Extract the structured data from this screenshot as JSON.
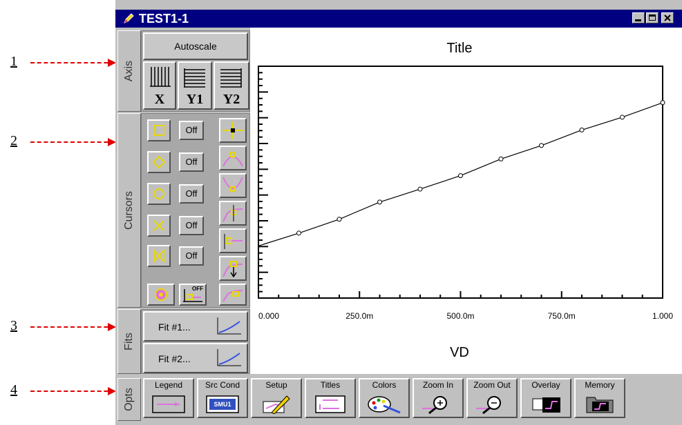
{
  "annotations": [
    {
      "number": "1"
    },
    {
      "number": "2"
    },
    {
      "number": "3"
    },
    {
      "number": "4"
    }
  ],
  "window": {
    "title": "TEST1-1"
  },
  "side_tabs": {
    "axis": "Axis",
    "cursors": "Cursors",
    "fits": "Fits",
    "opts": "Opts"
  },
  "axis_panel": {
    "autoscale_label": "Autoscale",
    "x_label": "X",
    "y1_label": "Y1",
    "y2_label": "Y2"
  },
  "cursors_panel": {
    "rows": [
      {
        "shape": "square-cursor-icon",
        "state": "Off"
      },
      {
        "shape": "diamond-cursor-icon",
        "state": "Off"
      },
      {
        "shape": "circle-cursor-icon",
        "state": "Off"
      },
      {
        "shape": "x-cursor-icon",
        "state": "Off"
      },
      {
        "shape": "bowtie-cursor-icon",
        "state": "Off"
      }
    ],
    "off_small_label": "OFF"
  },
  "fits_panel": {
    "fit1_label": "Fit #1...",
    "fit2_label": "Fit #2..."
  },
  "toolbar": {
    "legend": "Legend",
    "src_cond": "Src Cond",
    "src_cond_badge": "SMU1",
    "setup": "Setup",
    "titles": "Titles",
    "colors": "Colors",
    "zoom_in": "Zoom In",
    "zoom_out": "Zoom Out",
    "overlay": "Overlay",
    "memory": "Memory"
  },
  "chart_data": {
    "type": "line",
    "title": "Title",
    "xlabel": "VD",
    "ylabel": "",
    "x_tick_labels": [
      "0.000",
      "250.0m",
      "500.0m",
      "750.0m",
      "1.000"
    ],
    "x_ticks": [
      0,
      0.25,
      0.5,
      0.75,
      1.0
    ],
    "xlim": [
      0,
      1.0
    ],
    "ylim": [
      0,
      1.0
    ],
    "series": [
      {
        "x": [
          0.0,
          0.1,
          0.2,
          0.3,
          0.4,
          0.5,
          0.6,
          0.7,
          0.8,
          0.9,
          1.0
        ],
        "values": [
          0.225,
          0.28,
          0.34,
          0.414,
          0.47,
          0.528,
          0.6,
          0.658,
          0.725,
          0.78,
          0.843
        ]
      }
    ],
    "markers": "circle",
    "grid": false,
    "legend": "none",
    "colors": {
      "line": "#000000",
      "marker": "#000000"
    }
  }
}
